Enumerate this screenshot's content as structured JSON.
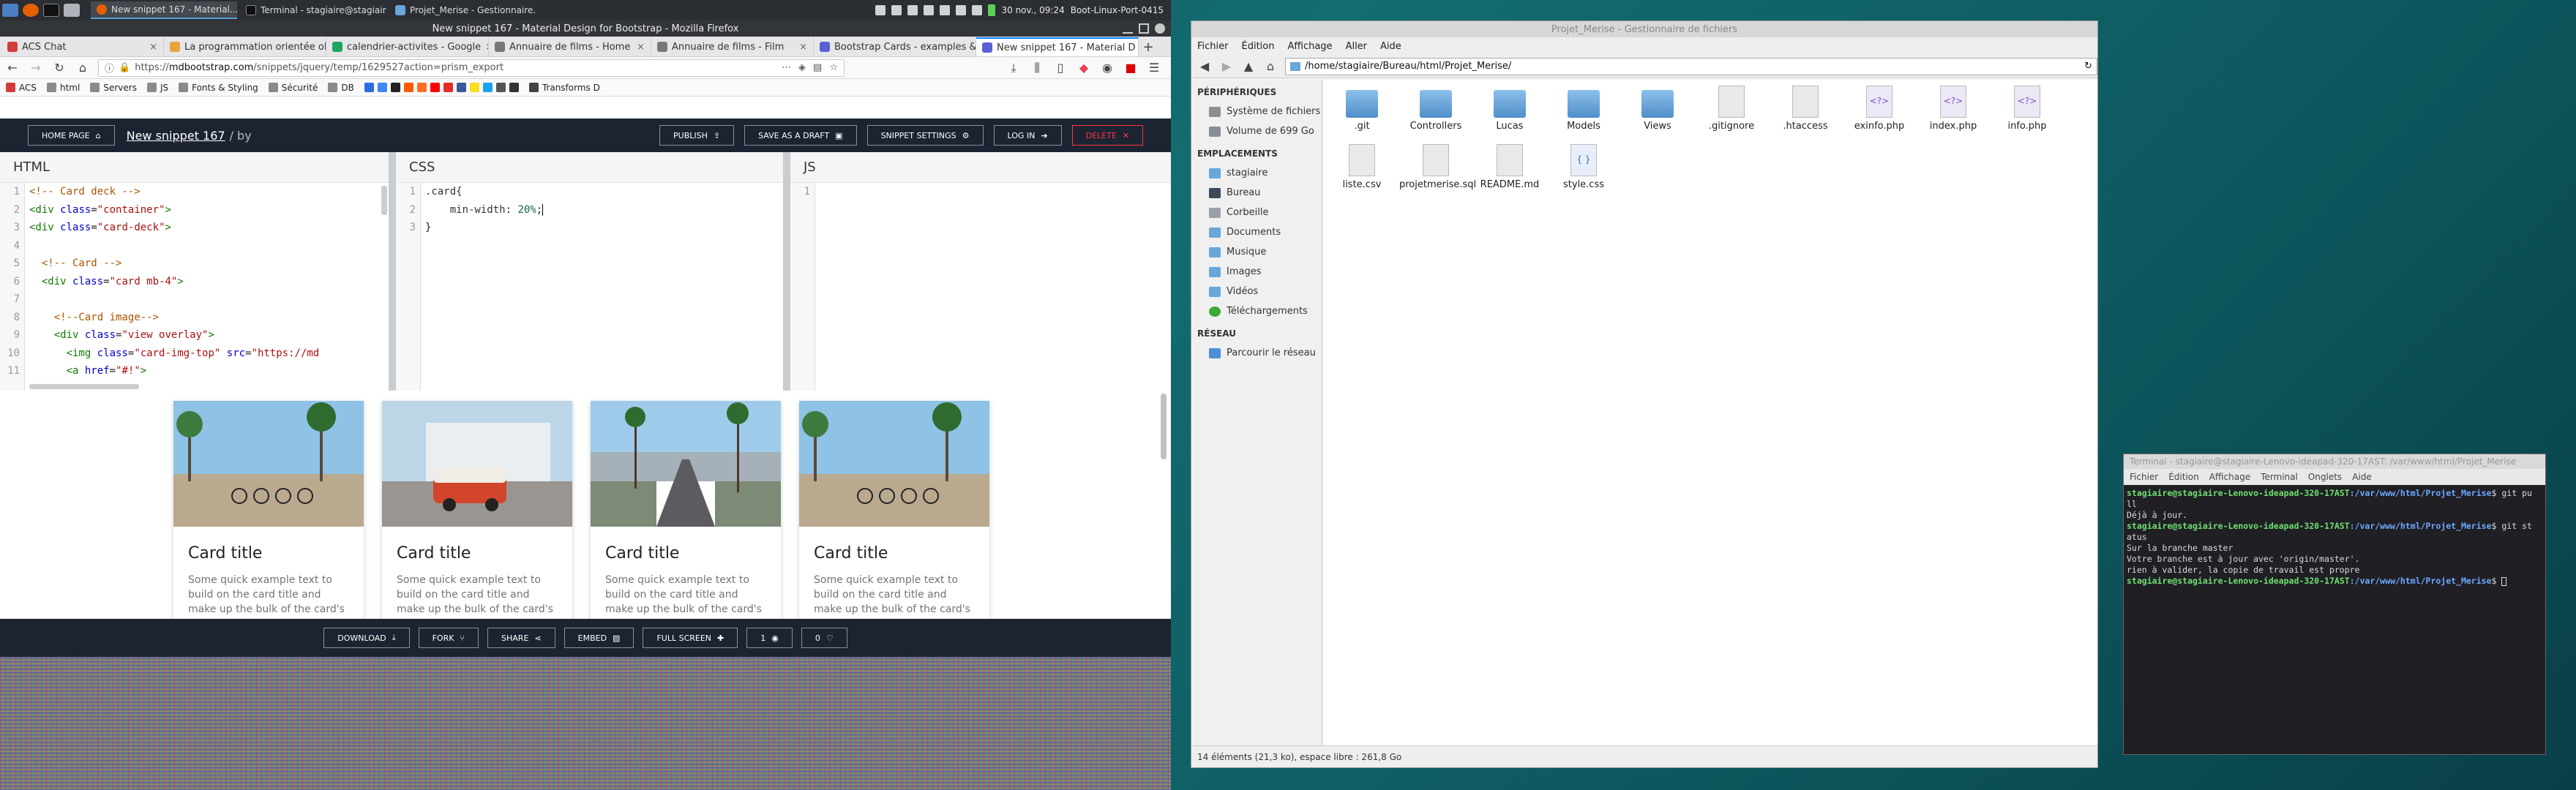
{
  "panel": {
    "tasks": [
      {
        "label": "New snippet 167 - Material...",
        "active": true
      },
      {
        "label": "Terminal - stagiaire@stagiair...",
        "active": false
      },
      {
        "label": "Projet_Merise - Gestionnaire...",
        "active": false
      }
    ],
    "clock": "30 nov., 09:24",
    "host": "Boot-Linux-Port-0415"
  },
  "firefox": {
    "title": "New snippet 167 - Material Design for Bootstrap - Mozilla Firefox",
    "tabs": [
      {
        "label": "ACS Chat",
        "color": "#d23c3c"
      },
      {
        "label": "La programmation orientée obje",
        "color": "#e8a33b"
      },
      {
        "label": "calendrier-activites - Google",
        "color": "#1fa463"
      },
      {
        "label": "Annuaire de films - Home",
        "color": "#777777"
      },
      {
        "label": "Annuaire de films - Film",
        "color": "#777777"
      },
      {
        "label": "Bootstrap Cards - examples &",
        "color": "#5a5fd6"
      },
      {
        "label": "New snippet 167 - Material D",
        "color": "#5a5fd6"
      }
    ],
    "url_prefix": "https://",
    "url_host": "mdbootstrap.com",
    "url_path": "/snippets/jquery/temp/1629527action=prism_export",
    "bookmarks": [
      "ACS",
      "html",
      "Servers",
      "JS",
      "Fonts & Styling",
      "Sécurité",
      "DB",
      "Transforms D"
    ]
  },
  "mdb": {
    "home_btn": "HOME PAGE",
    "snippet_title": "New snippet 167",
    "snippet_by": "/ by",
    "publish": "PUBLISH",
    "save_draft": "SAVE AS A DRAFT",
    "settings": "SNIPPET SETTINGS",
    "login": "LOG IN",
    "delete": "DELETE",
    "html_label": "HTML",
    "css_label": "CSS",
    "js_label": "JS",
    "html_lines": [
      "1",
      "2",
      "3",
      "4",
      "5",
      "6",
      "7",
      "8",
      "9",
      "10",
      "11"
    ],
    "css_lines": [
      "1",
      "2",
      "3"
    ],
    "js_lines": [
      "1"
    ],
    "download": "DOWNLOAD",
    "fork": "FORK",
    "share": "SHARE",
    "embed": "EMBED",
    "fullscreen": "FULL SCREEN",
    "views": "1",
    "likes": "0",
    "card_title": "Card title",
    "card_text": "Some quick example text to build on the card title and make up the bulk of the card's content."
  },
  "thunar": {
    "title": "Projet_Merise - Gestionnaire de fichiers",
    "menu": [
      "Fichier",
      "Édition",
      "Affichage",
      "Aller",
      "Aide"
    ],
    "path": "/home/stagiaire/Bureau/html/Projet_Merise/",
    "side_heads": [
      "PÉRIPHÉRIQUES",
      "EMPLACEMENTS",
      "RÉSEAU"
    ],
    "devices": [
      "Système de fichiers",
      "Volume de 699 Go"
    ],
    "places": [
      "stagiaire",
      "Bureau",
      "Corbeille",
      "Documents",
      "Musique",
      "Images",
      "Vidéos",
      "Téléchargements"
    ],
    "network": [
      "Parcourir le réseau"
    ],
    "files": [
      {
        "name": ".git",
        "type": "folder"
      },
      {
        "name": "Controllers",
        "type": "folder"
      },
      {
        "name": "Lucas",
        "type": "folder"
      },
      {
        "name": "Models",
        "type": "folder"
      },
      {
        "name": "Views",
        "type": "folder"
      },
      {
        "name": ".gitignore",
        "type": "text"
      },
      {
        "name": ".htaccess",
        "type": "text"
      },
      {
        "name": "exinfo.php",
        "type": "php"
      },
      {
        "name": "index.php",
        "type": "php"
      },
      {
        "name": "info.php",
        "type": "php"
      },
      {
        "name": "liste.csv",
        "type": "text"
      },
      {
        "name": "projetmerise.sql",
        "type": "text"
      },
      {
        "name": "README.md",
        "type": "text"
      },
      {
        "name": "style.css",
        "type": "css"
      }
    ],
    "status": "14 éléments (21,3 ko), espace libre : 261,8 Go"
  },
  "terminal": {
    "title": "Terminal - stagiaire@stagiaire-Lenovo-ideapad-320-17AST: /var/www/html/Projet_Merise",
    "menu": [
      "Fichier",
      "Édition",
      "Affichage",
      "Terminal",
      "Onglets",
      "Aide"
    ],
    "prompt_user": "stagiaire@stagiaire-Lenovo-ideapad-320-17AST",
    "prompt_path": ":/var/www/html/Projet_Merise",
    "cmd1": "$ git pu",
    "cmd1b": "ll",
    "out1": "Déjà à jour.",
    "cmd2": "$ git st",
    "cmd2b": "atus",
    "out2": [
      "Sur la branche master",
      "Votre branche est à jour avec 'origin/master'.",
      "",
      "rien à valider, la copie de travail est propre"
    ],
    "cmd3": "$ "
  },
  "colors": {
    "mdb_dark": "#1c2331",
    "mdb_red": "#ff3547",
    "ff_blue": "#0a84ff"
  }
}
